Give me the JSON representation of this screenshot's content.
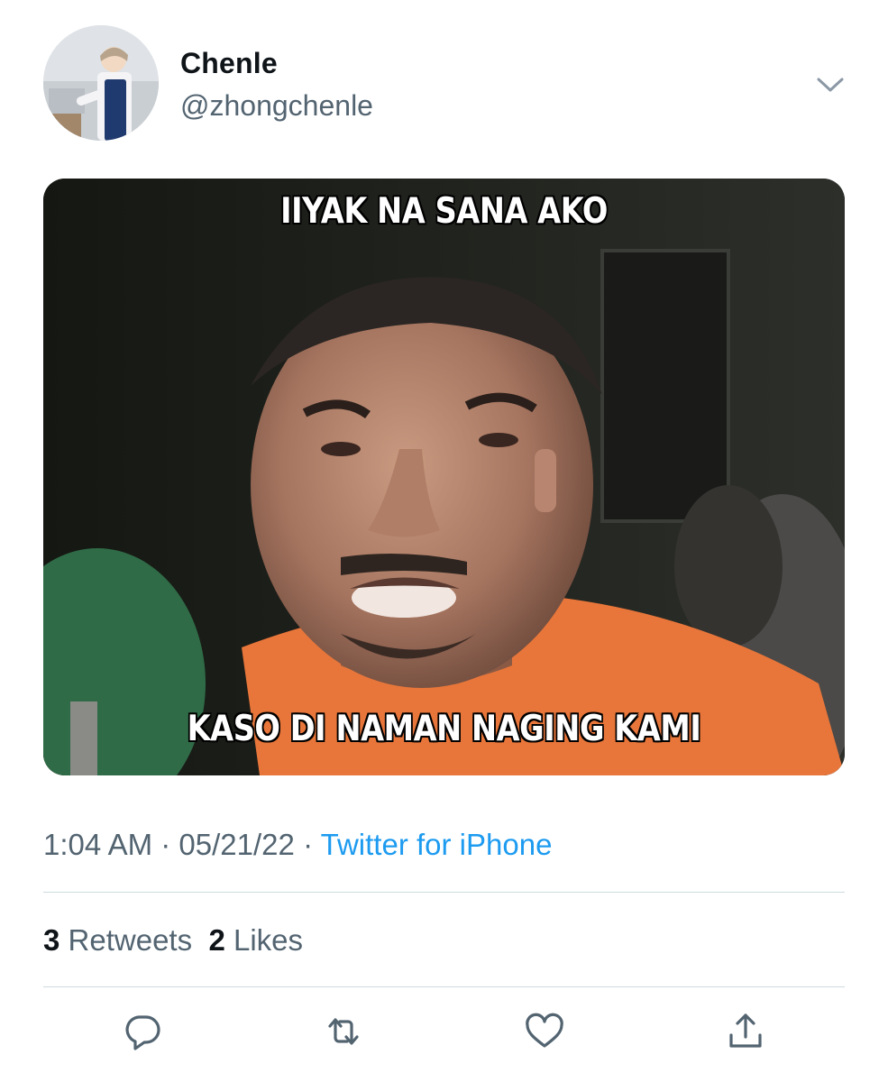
{
  "tweet": {
    "author_name": "Chenle",
    "author_handle": "@zhongchenle",
    "meme_top_text": "IIYAK NA SANA AKO",
    "meme_bottom_text": "KASO DI NAMAN NAGING KAMI",
    "time": "1:04 AM",
    "date": "05/21/22",
    "separator": "·",
    "source": "Twitter for iPhone",
    "retweets_count": "3",
    "retweets_label": "Retweets",
    "likes_count": "2",
    "likes_label": "Likes"
  },
  "icons": {
    "more": "chevron-down-icon",
    "reply": "reply-icon",
    "retweet": "retweet-icon",
    "like": "heart-icon",
    "share": "share-icon"
  },
  "colors": {
    "link": "#1d9bf0",
    "secondary_text": "#536471",
    "divider": "#cfd9de",
    "icon": "#536471"
  }
}
